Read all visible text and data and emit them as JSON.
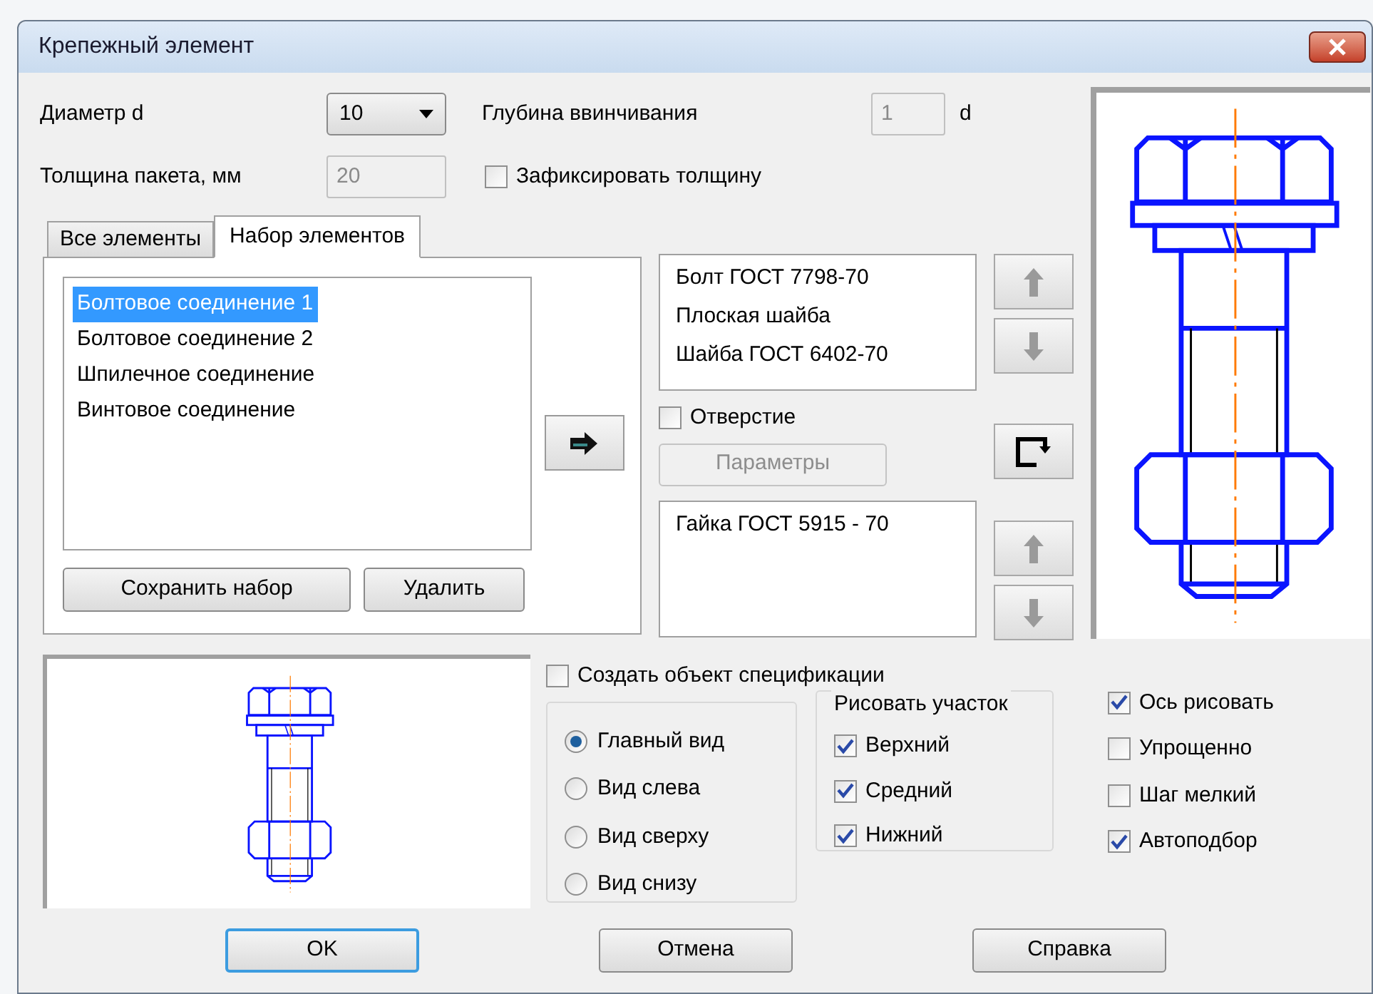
{
  "window": {
    "title": "Крепежный элемент"
  },
  "diameter": {
    "label": "Диаметр d",
    "value": "10"
  },
  "depth": {
    "label": "Глубина ввинчивания",
    "value": "1",
    "unit": "d"
  },
  "thickness": {
    "label": "Толщина пакета, мм",
    "value": "20",
    "disabled": true
  },
  "fix_thickness": {
    "label": "Зафиксировать толщину",
    "checked": false
  },
  "tabs": [
    {
      "label": "Все элементы",
      "selected": false
    },
    {
      "label": "Набор элементов",
      "selected": true
    }
  ],
  "element_sets": [
    {
      "label": "Болтовое соединение 1",
      "selected": true
    },
    {
      "label": "Болтовое соединение 2",
      "selected": false
    },
    {
      "label": "Шпилечное соединение",
      "selected": false
    },
    {
      "label": "Винтовое соединение",
      "selected": false
    }
  ],
  "set_buttons": [
    "Сохранить набор",
    "Удалить"
  ],
  "upper_parts": [
    "Болт ГОСТ 7798-70",
    "Плоская шайба",
    "Шайба ГОСТ 6402-70"
  ],
  "hole": {
    "label": "Отверстие",
    "checked": false
  },
  "params_button": {
    "label": "Параметры",
    "disabled": true
  },
  "lower_parts": [
    "Гайка ГОСТ 5915 - 70"
  ],
  "create_spec": {
    "label": "Создать объект спецификации",
    "checked": false
  },
  "views": [
    {
      "label": "Главный вид",
      "selected": true
    },
    {
      "label": "Вид слева",
      "selected": false
    },
    {
      "label": "Вид сверху",
      "selected": false
    },
    {
      "label": "Вид снизу",
      "selected": false
    }
  ],
  "draw_section": {
    "title": "Рисовать участок",
    "items": [
      {
        "label": "Верхний",
        "checked": true
      },
      {
        "label": "Средний",
        "checked": true
      },
      {
        "label": "Нижний",
        "checked": true
      }
    ]
  },
  "options": [
    {
      "label": "Ось рисовать",
      "checked": true
    },
    {
      "label": "Упрощенно",
      "checked": false
    },
    {
      "label": "Шаг мелкий",
      "checked": false
    },
    {
      "label": "Автоподбор",
      "checked": true
    }
  ],
  "buttons": [
    {
      "label": "OK",
      "default": true
    },
    {
      "label": "Отмена",
      "default": false
    },
    {
      "label": "Справка",
      "default": false
    }
  ]
}
